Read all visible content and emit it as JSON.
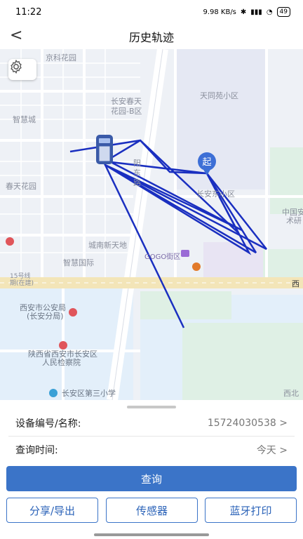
{
  "status": {
    "time": "11:22",
    "speed": "9.98 KB/s",
    "battery": "49"
  },
  "header": {
    "title": "历史轨迹",
    "back_glyph": "<"
  },
  "map": {
    "labels": {
      "l1": "京科花园",
      "l2": "长安春天",
      "l3": "花园-B区",
      "l4": "天同苑小区",
      "l5": "智慧城",
      "l6": "春天花园",
      "l7": "长安东小区",
      "l8": "中国安",
      "l9": "术研",
      "l10": "城南新天地",
      "l11": "智慧国际",
      "l12": "GOGO街区",
      "l13": "西安市公安局",
      "l14": "(长安分局)",
      "l15": "陕西省西安市长安区",
      "l16": "人民检察院",
      "l17": "长安区第三小学",
      "l18": "西",
      "l19": "西北",
      "l20": "阳",
      "l21": "东",
      "l22": "路",
      "l23": "15号线",
      "l24": "期(在建)"
    },
    "start_marker": "起",
    "track_color": "#1a2fc0"
  },
  "panel": {
    "device_label": "设备编号/名称:",
    "device_value": "15724030538 >",
    "time_label": "查询时间:",
    "time_value": "今天 >",
    "query_button": "查询",
    "share_button": "分享/导出",
    "sensor_button": "传感器",
    "print_button": "蓝牙打印"
  }
}
